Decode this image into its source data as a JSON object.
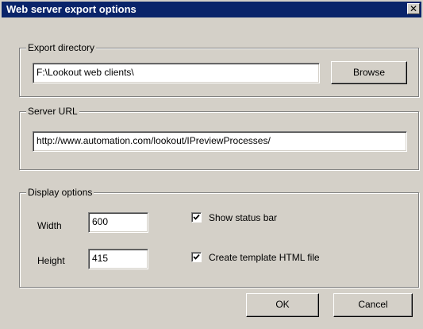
{
  "window": {
    "title": "Web server export options",
    "close_glyph": "✕"
  },
  "export_directory": {
    "legend": "Export directory",
    "value": "F:\\Lookout web clients\\",
    "browse_label": "Browse"
  },
  "server_url": {
    "legend": "Server URL",
    "value": "http://www.automation.com/lookout/IPreviewProcesses/"
  },
  "display_options": {
    "legend": "Display options",
    "width_label": "Width",
    "width_value": "600",
    "height_label": "Height",
    "height_value": "415",
    "show_status_bar_label": "Show status bar",
    "show_status_bar_checked": true,
    "create_template_label": "Create template HTML file",
    "create_template_checked": true
  },
  "buttons": {
    "ok_label": "OK",
    "cancel_label": "Cancel"
  },
  "colors": {
    "titlebar": "#0a246a",
    "face": "#d4d0c8"
  }
}
